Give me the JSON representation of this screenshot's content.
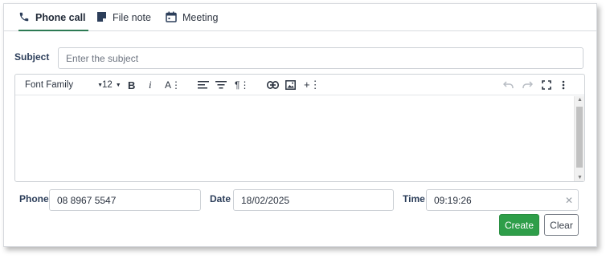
{
  "tabs": [
    {
      "label": "Phone call",
      "icon": "phone-icon",
      "active": true
    },
    {
      "label": "File note",
      "icon": "file-note-icon",
      "active": false
    },
    {
      "label": "Meeting",
      "icon": "calendar-icon",
      "active": false
    }
  ],
  "subject": {
    "label": "Subject",
    "placeholder": "Enter the subject",
    "value": ""
  },
  "toolbar": {
    "font_family": "Font Family",
    "font_size": "12",
    "bold": "B",
    "italic": "i",
    "font_format": "A⋮",
    "paragraph": "¶⋮",
    "insert_more": "+⋮"
  },
  "phone": {
    "label": "Phone",
    "value": "08 8967 5547"
  },
  "date": {
    "label": "Date",
    "value": "18/02/2025"
  },
  "time": {
    "label": "Time",
    "value": "09:19:26"
  },
  "buttons": {
    "create": "Create",
    "clear": "Clear"
  },
  "colors": {
    "accent": "#2e9e49",
    "label": "#2c3e5a",
    "active_tab_underline": "#2c7a53"
  }
}
